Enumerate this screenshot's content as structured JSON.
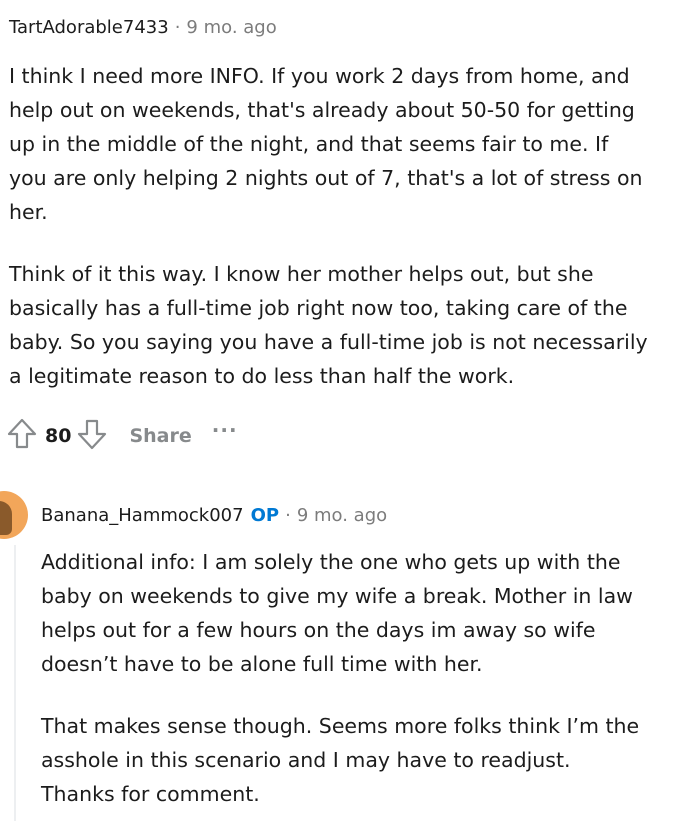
{
  "comments": [
    {
      "author": "TartAdorable7433",
      "separator": "·",
      "time": "9 mo. ago",
      "paragraphs": [
        [
          "I think I need more INFO. If you work 2 days from home, and",
          "help out on weekends, that's already about 50-50 for getting",
          "up in the middle of the night, and that seems fair to me. If",
          "you are only helping 2 nights out of 7, that's a lot of stress on",
          "her."
        ],
        [
          "Think of it this way. I know her mother helps out, but she",
          "basically has a full-time job right now too, taking care of the",
          "baby. So you saying you have a full-time job is not necessarily",
          "a legitimate reason to do less than half the work."
        ]
      ],
      "score": "80",
      "share_label": "Share",
      "more_label": "···",
      "icons": {
        "upvote": "upvote-arrow-icon",
        "downvote": "downvote-arrow-icon",
        "more": "more-options-icon"
      }
    },
    {
      "author": "Banana_Hammock007",
      "op_badge": "OP",
      "separator": "·",
      "time": "9 mo. ago",
      "paragraphs": [
        [
          "Additional info: I am solely the one who gets up with the",
          "baby on weekends to give my wife a break. Mother in law",
          "helps out for a few hours on the days im away so wife",
          "doesn’t have to be alone full time with her."
        ],
        [
          "That makes sense though. Seems more folks think I’m the",
          "asshole in this scenario and I may have to readjust.",
          "Thanks for comment."
        ]
      ],
      "avatar_icon": "user-avatar-icon"
    }
  ],
  "colors": {
    "text": "#1c1c1c",
    "meta": "#7c7c7c",
    "op": "#0079d3",
    "action": "#878a8c"
  }
}
